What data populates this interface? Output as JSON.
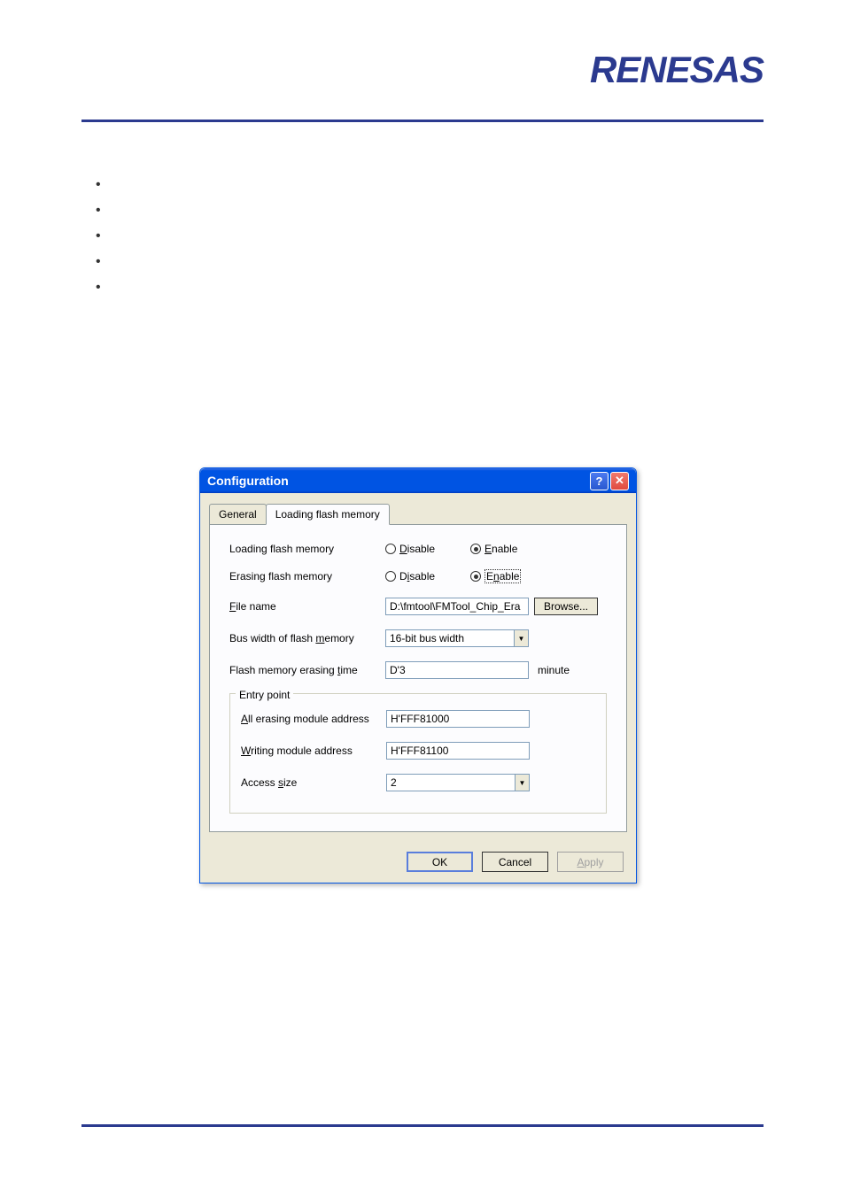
{
  "logo_text": "RENESAS",
  "dialog": {
    "title": "Configuration",
    "tabs": {
      "general": "General",
      "loading": "Loading flash memory"
    },
    "fields": {
      "loading_label": "Loading flash memory",
      "erasing_label": "Erasing flash memory",
      "filename_label": "File name",
      "filename_value": "D:\\fmtool\\FMTool_Chip_Era",
      "browse_label": "Browse...",
      "buswidth_label": "Bus width of flash memory",
      "buswidth_value": "16-bit bus width",
      "erasetime_label": "Flash memory erasing time",
      "erasetime_value": "D'3",
      "erasetime_unit": "minute",
      "entry_legend": "Entry point",
      "allerase_label": "All erasing module address",
      "allerase_value": "H'FFF81000",
      "writing_label": "Writing module address",
      "writing_value": "H'FFF81100",
      "access_label": "Access size",
      "access_value": "2"
    },
    "radio": {
      "disable": "Disable",
      "enable": "Enable"
    },
    "buttons": {
      "ok": "OK",
      "cancel": "Cancel",
      "apply": "Apply"
    }
  }
}
